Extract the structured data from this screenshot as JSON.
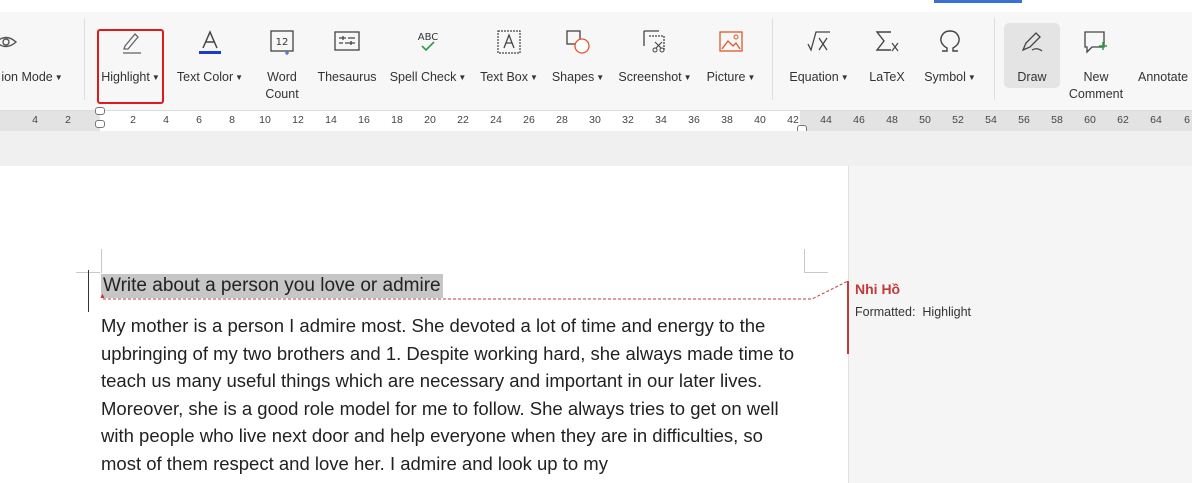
{
  "ribbon": {
    "view_mode_label": "ion Mode",
    "highlight_label": "Highlight",
    "text_color_label": "Text Color",
    "word_count_label": "Word Count",
    "thesaurus_label": "Thesaurus",
    "spell_check_label": "Spell Check",
    "text_box_label": "Text Box",
    "shapes_label": "Shapes",
    "screenshot_label": "Screenshot",
    "picture_label": "Picture",
    "equation_label": "Equation",
    "latex_label": "LaTeX",
    "symbol_label": "Symbol",
    "draw_label": "Draw",
    "new_comment_label": "New Comment",
    "annotate_label": "Annotate",
    "word_count_icon_text": "12",
    "spell_check_icon_text": "ABC",
    "accent_color": "#3b6fd8",
    "highlight_box_color": "#e01919"
  },
  "ruler": {
    "left_ticks": [
      "4",
      "2"
    ],
    "ticks": [
      "2",
      "4",
      "6",
      "8",
      "10",
      "12",
      "14",
      "16",
      "18",
      "20",
      "22",
      "24",
      "26",
      "28",
      "30",
      "32",
      "34",
      "36",
      "38",
      "40",
      "42",
      "44",
      "46",
      "48",
      "50",
      "52",
      "54",
      "56",
      "58",
      "60",
      "62",
      "64",
      "6"
    ]
  },
  "document": {
    "heading": "Write about a person you love or admire",
    "body": "My mother is a person I admire most. She devoted a lot of time and energy to the upbringing of my two brothers and 1. Despite working hard, she always made time to teach us many useful things which are necessary and important in our later lives. Moreover, she is a good role model for me to follow. She always tries to get on well with people who live next door and help everyone when they are in difficulties, so most of them respect and love her. I admire and look up to my",
    "highlight_color": "#c6c6c6"
  },
  "comment": {
    "author": "Nhi Hồ",
    "label": "Formatted:",
    "value": "Highlight",
    "color": "#c23a3a"
  }
}
